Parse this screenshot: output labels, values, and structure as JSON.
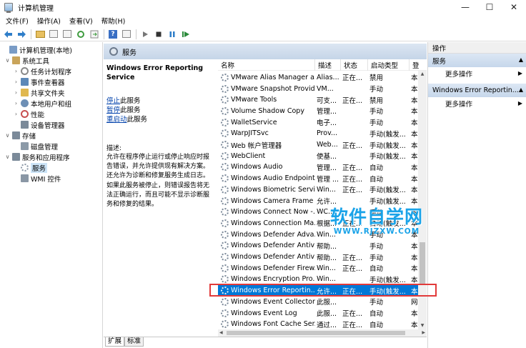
{
  "window": {
    "title": "计算机管理",
    "minimize": "—",
    "maximize": "☐",
    "close": "✕"
  },
  "menu": [
    "文件(F)",
    "操作(A)",
    "查看(V)",
    "帮助(H)"
  ],
  "tree": [
    {
      "label": "计算机管理(本地)",
      "expander": "",
      "level": 0,
      "icon": "computer-icon",
      "color": "#7a9cc6"
    },
    {
      "label": "系统工具",
      "expander": "∨",
      "level": 1,
      "icon": "tools-icon",
      "color": "#c9a45a"
    },
    {
      "label": "任务计划程序",
      "expander": "›",
      "level": 2,
      "icon": "clock-icon",
      "color": "#8a8a8a"
    },
    {
      "label": "事件查看器",
      "expander": "›",
      "level": 2,
      "icon": "event-icon",
      "color": "#5c88b8"
    },
    {
      "label": "共享文件夹",
      "expander": "›",
      "level": 2,
      "icon": "share-icon",
      "color": "#e0b850"
    },
    {
      "label": "本地用户和组",
      "expander": "›",
      "level": 2,
      "icon": "users-icon",
      "color": "#6d8fb5"
    },
    {
      "label": "性能",
      "expander": "›",
      "level": 2,
      "icon": "perf-icon",
      "color": "#c75050"
    },
    {
      "label": "设备管理器",
      "expander": "",
      "level": 2,
      "icon": "device-icon",
      "color": "#7b8a99"
    },
    {
      "label": "存储",
      "expander": "∨",
      "level": 1,
      "icon": "storage-icon",
      "color": "#7b8a99"
    },
    {
      "label": "磁盘管理",
      "expander": "",
      "level": 2,
      "icon": "disk-icon",
      "color": "#8c9aa8"
    },
    {
      "label": "服务和应用程序",
      "expander": "∨",
      "level": 1,
      "icon": "apps-icon",
      "color": "#7b8a99"
    },
    {
      "label": "服务",
      "expander": "",
      "level": 2,
      "icon": "services-icon",
      "color": "#8a97a5",
      "selected": true
    },
    {
      "label": "WMI 控件",
      "expander": "",
      "level": 2,
      "icon": "wmi-icon",
      "color": "#8a97a5"
    }
  ],
  "middle": {
    "header": "服务",
    "selected_service": "Windows Error Reporting Service",
    "links": [
      {
        "link": "停止",
        "rest": "此服务"
      },
      {
        "link": "暂停",
        "rest": "此服务"
      },
      {
        "link": "重启动",
        "rest": "此服务"
      }
    ],
    "desc_label": "描述:",
    "desc_body": "允许在程序停止运行或停止响应时报告错误，并允许提供现有解决方案。还允许为诊断和修复服务生成日志。如果此服务被停止，则错误报告将无法正确运行，而且可能不显示诊断服务和修复的结果。",
    "tabs": [
      "扩展",
      "标准"
    ]
  },
  "list": {
    "columns": [
      "名称",
      "描述",
      "状态",
      "启动类型",
      "登"
    ],
    "sort_indicator": "^",
    "rows": [
      [
        "VMware Alias Manager a...",
        "Alias...",
        "正在...",
        "禁用",
        "本"
      ],
      [
        "VMware Snapshot Provid...",
        "VM...",
        "",
        "手动",
        "本"
      ],
      [
        "VMware Tools",
        "可支...",
        "正在...",
        "禁用",
        "本"
      ],
      [
        "Volume Shadow Copy",
        "管理...",
        "",
        "手动",
        "本"
      ],
      [
        "WalletService",
        "电子...",
        "",
        "手动",
        "本"
      ],
      [
        "WarpJITSvc",
        "Prov...",
        "",
        "手动(触发...",
        "本"
      ],
      [
        "Web 帐户管理器",
        "Web...",
        "正在...",
        "手动(触发...",
        "本"
      ],
      [
        "WebClient",
        "使基...",
        "",
        "手动(触发...",
        "本"
      ],
      [
        "Windows Audio",
        "管理...",
        "正在...",
        "自动",
        "本"
      ],
      [
        "Windows Audio Endpoint...",
        "管理 ...",
        "正在...",
        "自动",
        "本"
      ],
      [
        "Windows Biometric Servi...",
        "Win...",
        "正在...",
        "手动(触发...",
        "本"
      ],
      [
        "Windows Camera Frame ...",
        "允许...",
        "",
        "手动(触发...",
        "本"
      ],
      [
        "Windows Connect Now -...",
        "WC...",
        "",
        "手动",
        "本"
      ],
      [
        "Windows Connection Ma...",
        "根据...",
        "正在...",
        "自动(触发...",
        "本"
      ],
      [
        "Windows Defender Adva...",
        "Win...",
        "",
        "手动",
        "本"
      ],
      [
        "Windows Defender Antivi...",
        "帮助...",
        "",
        "手动",
        "本"
      ],
      [
        "Windows Defender Antivi...",
        "帮助...",
        "正在...",
        "手动",
        "本"
      ],
      [
        "Windows Defender Firew...",
        "Win...",
        "正在...",
        "自动",
        "本"
      ],
      [
        "Windows Encryption Pro...",
        "Win...",
        "",
        "手动(触发...",
        "本"
      ],
      [
        "Windows Error Reportin...",
        "允许...",
        "正在...",
        "手动(触发...",
        "本"
      ],
      [
        "Windows Event Collector",
        "此服...",
        "",
        "手动",
        "网"
      ],
      [
        "Windows Event Log",
        "此服...",
        "正在...",
        "自动",
        "本"
      ],
      [
        "Windows Font Cache Ser...",
        "通过...",
        "正在...",
        "自动",
        "本"
      ]
    ],
    "selected_index": 19
  },
  "actions": {
    "header": "操作",
    "sections": [
      {
        "title": "服务",
        "items": [
          "更多操作"
        ]
      },
      {
        "title": "Windows Error Reportin...",
        "items": [
          "更多操作"
        ]
      }
    ]
  },
  "watermark": {
    "main": "软件自学网",
    "sub": "WWW.RJZXW.COM"
  }
}
